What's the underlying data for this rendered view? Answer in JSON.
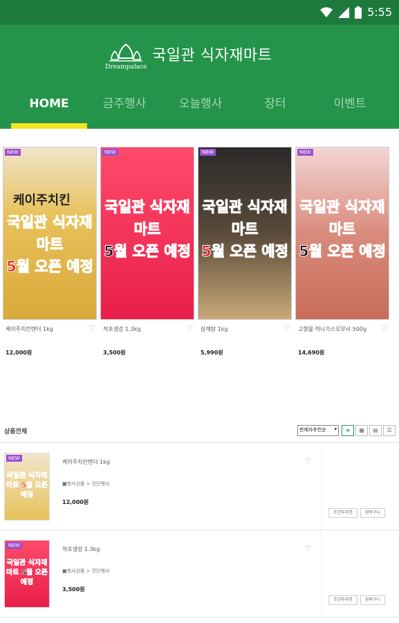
{
  "status_bar": {
    "time": "5:55",
    "icons": [
      "wifi-icon",
      "signal-icon",
      "battery-icon"
    ]
  },
  "app": {
    "logo_text": "Dreampalace",
    "title": "국일관 식자재마트"
  },
  "tabs": [
    {
      "label": "HOME",
      "active": true
    },
    {
      "label": "금주행사",
      "active": false
    },
    {
      "label": "오늘행사",
      "active": false
    },
    {
      "label": "장터",
      "active": false
    },
    {
      "label": "이벤트",
      "active": false
    }
  ],
  "featured": [
    {
      "badge": "NEW",
      "top_label": "케이주치킨",
      "promo_line1": "국일관 식자재마트",
      "promo_line2": "5월 오픈 예정",
      "name": "케이주치킨텐더 1kg",
      "price": "12,000원"
    },
    {
      "badge": "NEW",
      "top_label": "",
      "promo_line1": "국일관 식자재마트",
      "promo_line2": "5월 오픈 예정",
      "name": "적초생강 1.3kg",
      "price": "3,500원"
    },
    {
      "badge": "NEW",
      "top_label": "",
      "promo_line1": "국일관 식자재마트",
      "promo_line2": "5월 오픈 예정",
      "name": "삼계탕 1kg",
      "price": "5,990원"
    },
    {
      "badge": "NEW",
      "top_label": "",
      "promo_line1": "국일관 식자재마트",
      "promo_line2": "5월 오픈 예정",
      "name": "고향울 하나가스오부시 500g",
      "price": "14,690원"
    }
  ],
  "list": {
    "header_label": "상품전체",
    "sort_selected": "판매자추천순",
    "view_buttons": [
      "list-view-icon",
      "grid-view-icon",
      "grid-small-icon",
      "list-compact-icon"
    ],
    "items": [
      {
        "badge": "NEW",
        "name": "케이주치킨텐더 1kg",
        "category": "■행사상품 > 전단행사",
        "price": "12,000원",
        "btn_compare": "조건부추천",
        "btn_cart": "장바구니",
        "promo": "국일관 식자재마트 5월 오픈 예정"
      },
      {
        "badge": "NEW",
        "name": "적초생강 1.3kg",
        "category": "■행사상품 > 전단행사",
        "price": "3,500원",
        "btn_compare": "조건부추천",
        "btn_cart": "장바구니",
        "promo": "국일관 식자재마트 5월 오픈 예정"
      }
    ]
  },
  "colors": {
    "status_bar": "#1e7a3c",
    "app_bar": "#24944a",
    "tab_indicator": "#f7e321",
    "badge": "#9b4fd0",
    "promo_red": "#e8101b"
  }
}
